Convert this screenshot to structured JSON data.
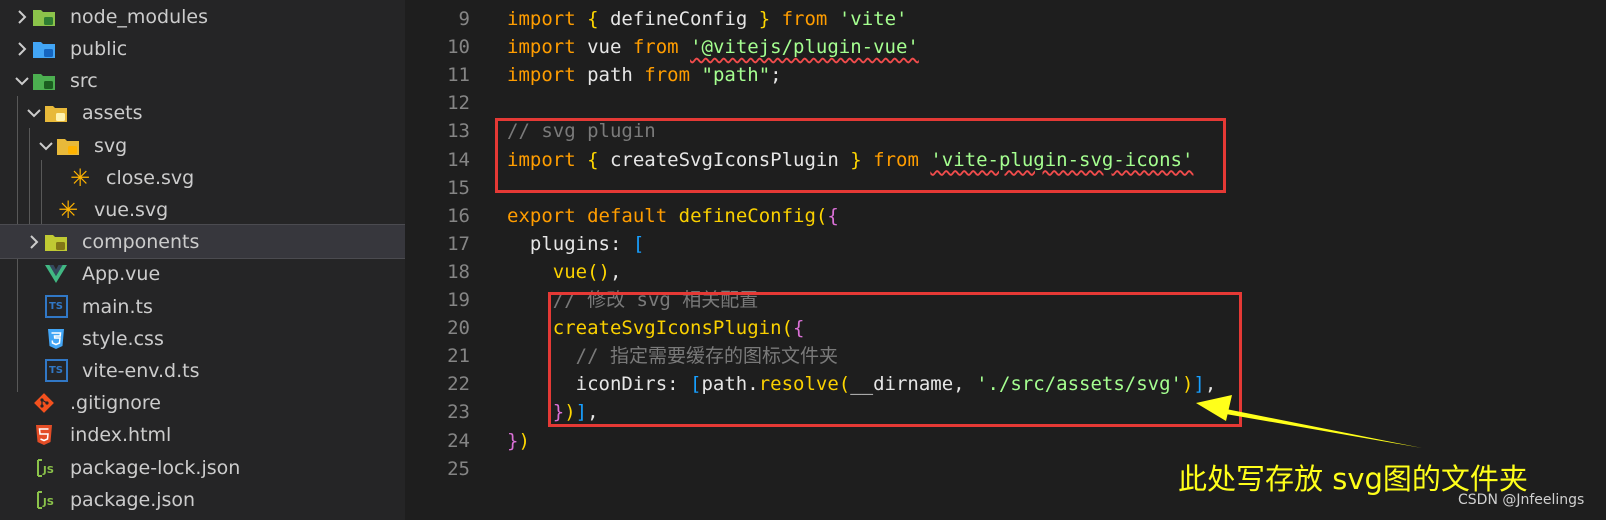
{
  "explorer": {
    "items": [
      {
        "label": "node_modules",
        "icon": "folder-node-modules-icon",
        "expanded": false
      },
      {
        "label": "public",
        "icon": "folder-public-icon",
        "expanded": false
      },
      {
        "label": "src",
        "icon": "folder-src-icon",
        "expanded": true
      },
      {
        "label": "assets",
        "icon": "folder-assets-icon",
        "expanded": true
      },
      {
        "label": "svg",
        "icon": "folder-svg-icon",
        "expanded": true
      },
      {
        "label": "close.svg",
        "icon": "svg-file-icon"
      },
      {
        "label": "vue.svg",
        "icon": "svg-file-icon"
      },
      {
        "label": "components",
        "icon": "folder-components-icon",
        "expanded": false,
        "selected": true
      },
      {
        "label": "App.vue",
        "icon": "vue-file-icon"
      },
      {
        "label": "main.ts",
        "icon": "ts-file-icon"
      },
      {
        "label": "style.css",
        "icon": "css-file-icon"
      },
      {
        "label": "vite-env.d.ts",
        "icon": "ts-file-icon"
      },
      {
        "label": ".gitignore",
        "icon": "git-file-icon"
      },
      {
        "label": "index.html",
        "icon": "html-file-icon"
      },
      {
        "label": "package-lock.json",
        "icon": "json-file-icon"
      },
      {
        "label": "package.json",
        "icon": "json-file-icon"
      }
    ],
    "colors": {
      "folder": "#e8b93a",
      "vue": "#41b883",
      "ts": "#3178c6",
      "css": "#42a5f5",
      "git": "#f4511e",
      "html": "#e44d26",
      "json": "#8bc34a",
      "svg_file": "#ffb300"
    }
  },
  "editor": {
    "lines": [
      {
        "num": "9",
        "tokens": [
          [
            "kw",
            "import"
          ],
          [
            "id",
            " "
          ],
          [
            "b1",
            "{"
          ],
          [
            "id",
            " defineConfig "
          ],
          [
            "b1",
            "}"
          ],
          [
            "id",
            " "
          ],
          [
            "kw",
            "from"
          ],
          [
            "id",
            " "
          ],
          [
            "str",
            "'vite'"
          ]
        ]
      },
      {
        "num": "10",
        "tokens": [
          [
            "kw",
            "import"
          ],
          [
            "id",
            " vue "
          ],
          [
            "kw",
            "from"
          ],
          [
            "id",
            " "
          ],
          [
            "str squig",
            "'@vitejs/plugin-vue'"
          ]
        ]
      },
      {
        "num": "11",
        "tokens": [
          [
            "kw",
            "import"
          ],
          [
            "id",
            " path "
          ],
          [
            "kw",
            "from"
          ],
          [
            "id",
            " "
          ],
          [
            "str",
            "\"path\""
          ],
          [
            "id",
            ";"
          ]
        ]
      },
      {
        "num": "12",
        "tokens": []
      },
      {
        "num": "13",
        "tokens": [
          [
            "cm",
            "// svg plugin"
          ]
        ]
      },
      {
        "num": "14",
        "tokens": [
          [
            "kw",
            "import"
          ],
          [
            "id",
            " "
          ],
          [
            "b1",
            "{"
          ],
          [
            "id",
            " createSvgIconsPlugin "
          ],
          [
            "b1",
            "}"
          ],
          [
            "id",
            " "
          ],
          [
            "kw",
            "from"
          ],
          [
            "id",
            " "
          ],
          [
            "str squig",
            "'vite-plugin-svg-icons'"
          ]
        ]
      },
      {
        "num": "15",
        "tokens": []
      },
      {
        "num": "16",
        "tokens": [
          [
            "kw",
            "export"
          ],
          [
            "id",
            " "
          ],
          [
            "kw",
            "default"
          ],
          [
            "id",
            " "
          ],
          [
            "fn",
            "defineConfig"
          ],
          [
            "b1",
            "("
          ],
          [
            "b2",
            "{"
          ]
        ]
      },
      {
        "num": "17",
        "tokens": [
          [
            "id",
            "  plugins: "
          ],
          [
            "b3",
            "["
          ]
        ]
      },
      {
        "num": "18",
        "tokens": [
          [
            "id",
            "    "
          ],
          [
            "fn",
            "vue"
          ],
          [
            "b1",
            "()"
          ],
          [
            "id",
            ","
          ]
        ]
      },
      {
        "num": "19",
        "tokens": [
          [
            "cm",
            "    // 修改 svg 相关配置"
          ]
        ]
      },
      {
        "num": "20",
        "tokens": [
          [
            "id",
            "    "
          ],
          [
            "fn",
            "createSvgIconsPlugin"
          ],
          [
            "b1",
            "("
          ],
          [
            "b2",
            "{"
          ]
        ]
      },
      {
        "num": "21",
        "tokens": [
          [
            "cm",
            "      // 指定需要缓存的图标文件夹"
          ]
        ]
      },
      {
        "num": "22",
        "tokens": [
          [
            "id",
            "      iconDirs: "
          ],
          [
            "b3",
            "["
          ],
          [
            "id",
            "path."
          ],
          [
            "fn",
            "resolve"
          ],
          [
            "b1",
            "("
          ],
          [
            "id",
            "__dirname, "
          ],
          [
            "str",
            "'./src/assets/svg'"
          ],
          [
            "b1",
            ")"
          ],
          [
            "b3",
            "]"
          ],
          [
            "id",
            ","
          ]
        ]
      },
      {
        "num": "23",
        "tokens": [
          [
            "id",
            "    "
          ],
          [
            "b2",
            "}"
          ],
          [
            "b1",
            ")"
          ],
          [
            "b3",
            "]"
          ],
          [
            "id",
            ","
          ]
        ]
      },
      {
        "num": "24",
        "tokens": [
          [
            "b2",
            "}"
          ],
          [
            "b1",
            ")"
          ]
        ]
      },
      {
        "num": "25",
        "tokens": []
      }
    ]
  },
  "annotation": {
    "text": "此处写存放 svg图的文件夹",
    "box_color": "#e53935",
    "arrow_color": "#ffff1a"
  },
  "watermark": "CSDN @Jnfeelings"
}
